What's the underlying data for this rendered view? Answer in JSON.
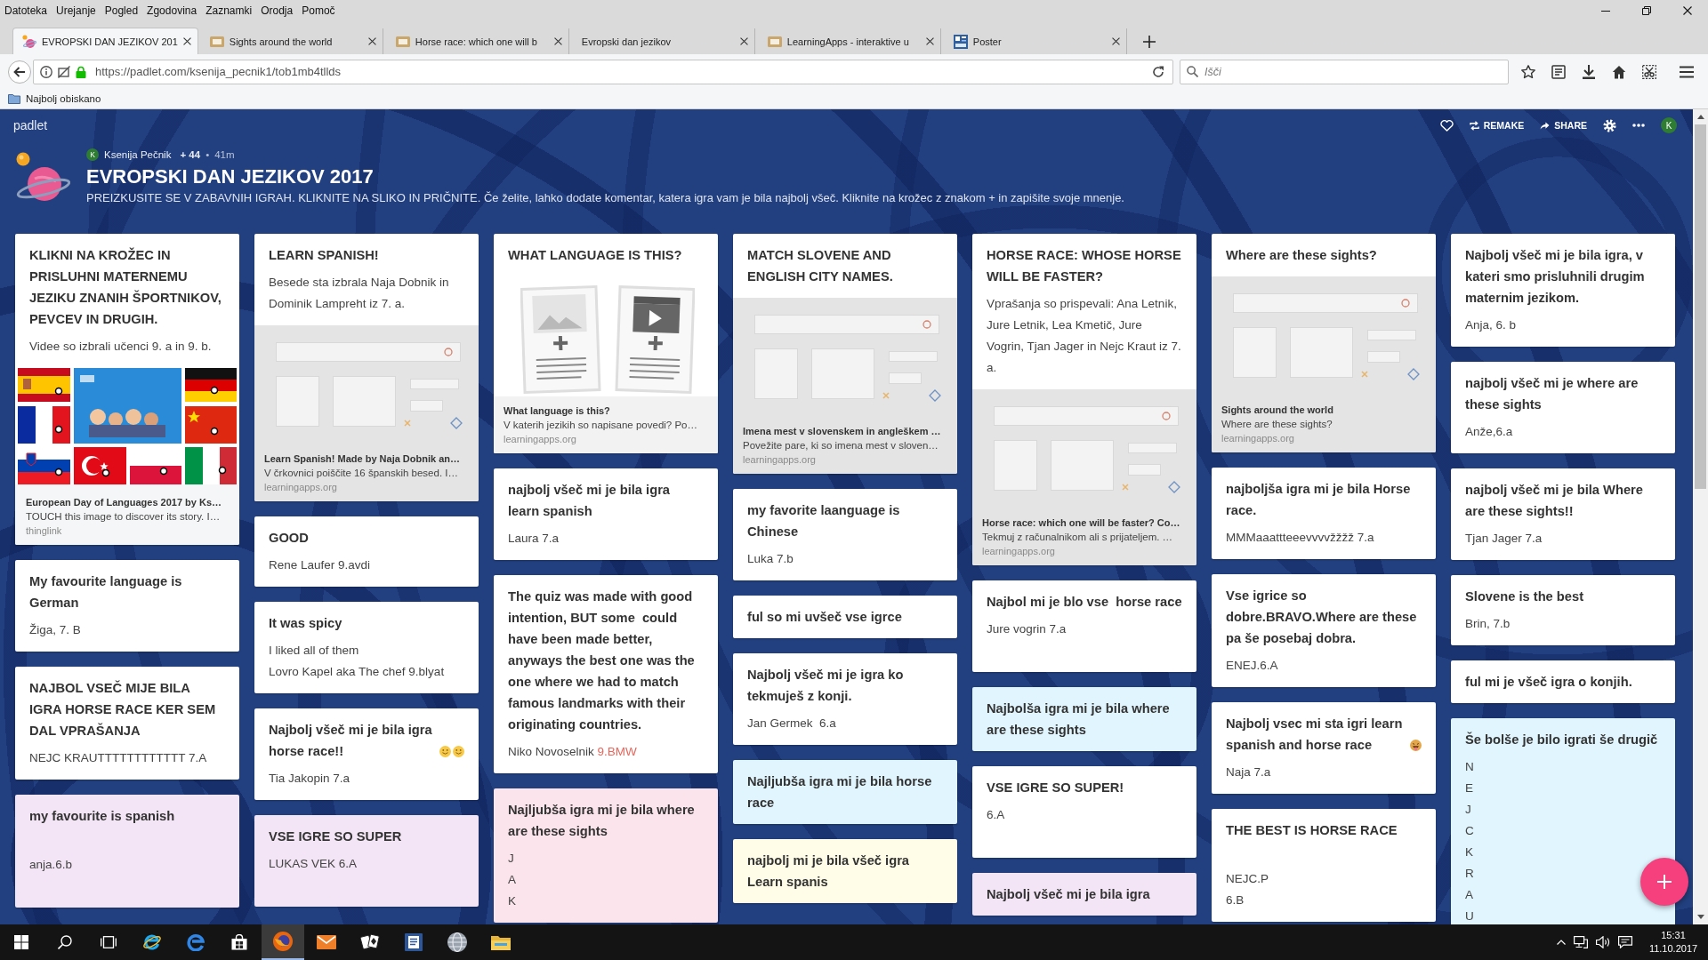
{
  "menu_bar": {
    "items": [
      "Datoteka",
      "Urejanje",
      "Pogled",
      "Zgodovina",
      "Zaznamki",
      "Orodja",
      "Pomoč"
    ]
  },
  "tabs": [
    {
      "label": "EVROPSKI DAN JEZIKOV 201",
      "selected": true,
      "kind": "padlet"
    },
    {
      "label": "Sights around the world",
      "selected": false,
      "kind": "learningapps"
    },
    {
      "label": "Horse race: which one will b",
      "selected": false,
      "kind": "learningapps"
    },
    {
      "label": "Evropski dan jezikov",
      "selected": false,
      "kind": "none"
    },
    {
      "label": "LearningApps - interaktive u",
      "selected": false,
      "kind": "learningapps"
    },
    {
      "label": "Poster",
      "selected": false,
      "kind": "poster"
    }
  ],
  "nav_bar": {
    "url": "https://padlet.com/ksenija_pecnik1/tob1mb4tllds",
    "search": {
      "placeholder": "Išči"
    }
  },
  "bookmarks_bar": {
    "items": [
      "Najbolj obiskano"
    ]
  },
  "padlet": {
    "brand": "padlet",
    "actions": [
      {
        "kind": "remake",
        "label": "REMAKE"
      },
      {
        "kind": "share",
        "label": "SHARE"
      }
    ],
    "user_initial": "K",
    "author": {
      "initial": "K",
      "name": "Ksenija Pečnik",
      "points": "+ 44",
      "separator": "•",
      "time": "41m"
    },
    "title": "EVROPSKI DAN JEZIKOV 2017",
    "description": "PREIZKUSITE SE V ZABAVNIH IGRAH. KLIKNITE NA SLIKO IN PRIČNITE. Če želite, lahko dodate komentar, katera igra vam je bila najbolj všeč. Kliknite na krožec z znakom + in zapišite svoje mnenje.",
    "columns": [
      {
        "cards": [
          {
            "color": "#ffffff",
            "title": "KLIKNI NA KROŽEC IN PRISLUHNI MATERNEMU JEZIKU ZNANIH ŠPORTNIKOV, PEVCEV IN DRUGIH.",
            "lines": [
              {
                "kind": "text",
                "text": "Videe so izbrali učenci 9. a in 9. b."
              }
            ],
            "attachment": {
              "kind": "thinglink",
              "title": "European Day of Languages 2017 by Ks…",
              "description": "TOUCH this image to discover its story. I…",
              "source": "thinglink"
            }
          },
          {
            "color": "#ffffff",
            "title": "My favourite language is German",
            "lines": [
              {
                "kind": "text",
                "text": "Žiga, 7. B"
              }
            ]
          },
          {
            "color": "#ffffff",
            "title": "NAJBOL VSEČ MIJE BILA IGRA HORSE RACE KER SEM DAL VPRAŠANJA",
            "lines": [
              {
                "kind": "text",
                "text": "NEJC KRAUTTTTTTTTTTTT 7.A"
              }
            ]
          },
          {
            "color": "#f3e5f5",
            "title": "my favourite is spanish",
            "lines": [
              {
                "kind": "blank"
              },
              {
                "kind": "text",
                "text": "anja.6.b"
              },
              {
                "kind": "blank"
              }
            ]
          }
        ]
      },
      {
        "cards": [
          {
            "color": "#ffffff",
            "title": "LEARN SPANISH!",
            "lines": [
              {
                "kind": "text",
                "text": "Besede sta izbrala Naja Dobnik in Dominik Lampreht iz 7. a."
              }
            ],
            "attachment": {
              "kind": "learningapps",
              "title": "Learn Spanish! Made by Naja Dobnik an…",
              "description": "V črkovnici poiščite 16 španskih besed. I…",
              "source": "learningapps.org"
            }
          },
          {
            "color": "#ffffff",
            "title": "GOOD",
            "lines": [
              {
                "kind": "text",
                "text": "Rene Laufer 9.avdi"
              }
            ]
          },
          {
            "color": "#ffffff",
            "title": "It was spicy",
            "lines": [
              {
                "kind": "text",
                "text": "I liked all of them"
              },
              {
                "kind": "text",
                "text": "Lovro Kapel aka The chef 9.blyat"
              }
            ]
          },
          {
            "color": "#ffffff",
            "title": "Najbolj všeč mi je bila igra horse race!!",
            "title_icons": [
              {
                "kind": "smile"
              },
              {
                "kind": "smile"
              }
            ],
            "lines": [
              {
                "kind": "text",
                "text": "Tia Jakopin 7.a"
              }
            ]
          },
          {
            "color": "#f3e5f5",
            "title": "VSE IGRE SO SUPER",
            "lines": [
              {
                "kind": "text",
                "text": "LUKAS VEK 6.A"
              },
              {
                "kind": "blank"
              }
            ]
          }
        ]
      },
      {
        "cards": [
          {
            "color": "#ffffff",
            "title": "WHAT LANGUAGE IS THIS?",
            "attachment": {
              "kind": "document",
              "title": "What language is this?",
              "description": "V katerih jezikih so napisane povedi? Po…",
              "source": "learningapps.org"
            }
          },
          {
            "color": "#ffffff",
            "title": "najbolj všeč mi je bila igra learn spanish",
            "lines": [
              {
                "kind": "text",
                "text": "Laura 7.a"
              }
            ]
          },
          {
            "color": "#ffffff",
            "title": "The quiz was made with good intention, BUT some  could have been made better, anyways the best one was the one where we had to match famous landmarks with their originating countries.",
            "lines": [
              {
                "kind": "text",
                "text": "Niko Novoselnik",
                "link": "9.BMW"
              }
            ]
          },
          {
            "color": "#fce4ec",
            "title": "Najljubša igra mi je bila where are these sights",
            "lines": [
              {
                "kind": "text",
                "text": "J"
              },
              {
                "kind": "text",
                "text": "A"
              },
              {
                "kind": "text",
                "text": "K"
              }
            ]
          }
        ]
      },
      {
        "cards": [
          {
            "color": "#ffffff",
            "title": "MATCH SLOVENE AND ENGLISH CITY NAMES.",
            "attachment": {
              "kind": "learningapps",
              "title": "Imena mest v slovenskem in angleškem …",
              "description": "Povežite pare, ki so imena mest v sloven…",
              "source": "learningapps.org"
            }
          },
          {
            "color": "#ffffff",
            "title": "my favorite laanguage is Chinese",
            "lines": [
              {
                "kind": "text",
                "text": "Luka 7.b"
              }
            ]
          },
          {
            "color": "#ffffff",
            "title": "ful so mi uvšeč vse igrce"
          },
          {
            "color": "#ffffff",
            "title": "Najbolj všeč mi je igra ko tekmuješ z konji.",
            "lines": [
              {
                "kind": "text",
                "text": "Jan Germek  6.a"
              }
            ]
          },
          {
            "color": "#e1f5fe",
            "title": "Najljubša igra mi je bila horse race"
          },
          {
            "color": "#fffde7",
            "title": "najbolj mi je bila všeč igra Learn spanis"
          }
        ]
      },
      {
        "cards": [
          {
            "color": "#ffffff",
            "title": "HORSE RACE: WHOSE HORSE WILL BE FASTER?",
            "lines": [
              {
                "kind": "text",
                "text": "Vprašanja so prispevali: Ana Letnik, Jure Letnik, Lea Kmetič, Jure Vogrin, Tjan Jager in Nejc Kraut iz 7. a."
              }
            ],
            "attachment": {
              "kind": "learningapps",
              "title": "Horse race: which one will be faster? Co…",
              "description": "Tekmuj z računalnikom ali s prijateljem. …",
              "source": "learningapps.org"
            }
          },
          {
            "color": "#ffffff",
            "title": "Najbol mi je blo vse  horse race",
            "lines": [
              {
                "kind": "text",
                "text": "Jure vogrin 7.a"
              },
              {
                "kind": "blank"
              }
            ]
          },
          {
            "color": "#e1f5fe",
            "title": "Najbolša igra mi je bila where are these sights"
          },
          {
            "color": "#ffffff",
            "title": "VSE IGRE SO SUPER!",
            "lines": [
              {
                "kind": "text",
                "text": "6.A"
              },
              {
                "kind": "blank"
              }
            ]
          },
          {
            "color": "#f3e5f5",
            "title": "Najbolj všeč mi je bila igra"
          }
        ]
      },
      {
        "cards": [
          {
            "color": "#ffffff",
            "title": "Where are these sights?",
            "attachment": {
              "kind": "learningapps",
              "title": "Sights around the world",
              "description": "Where are these sights?",
              "source": "learningapps.org"
            }
          },
          {
            "color": "#ffffff",
            "title": "najboljša igra mi je bila Horse race.",
            "lines": [
              {
                "kind": "text",
                "text": "MMMaaattteeevvvvžžžž 7.a"
              }
            ]
          },
          {
            "color": "#ffffff",
            "title": "Vse igrice so dobre.BRAVO.Where are these pa še posebaj dobra.",
            "lines": [
              {
                "kind": "text",
                "text": "ENEJ.6.A"
              }
            ]
          },
          {
            "color": "#ffffff",
            "title": "Najbolj vsec mi sta igri learn spanish and horse race",
            "title_icons": [
              {
                "kind": "tongue"
              }
            ],
            "lines": [
              {
                "kind": "text",
                "text": "Naja 7.a"
              }
            ]
          },
          {
            "color": "#ffffff",
            "title": "THE BEST IS HORSE RACE",
            "lines": [
              {
                "kind": "blank"
              },
              {
                "kind": "text",
                "text": "NEJC.P"
              },
              {
                "kind": "text",
                "text": "6.B"
              }
            ]
          }
        ]
      },
      {
        "cards": [
          {
            "color": "#ffffff",
            "title": "Najbolj všeč mi je bila igra, v kateri smo prisluhnili drugim maternim jezikom.",
            "lines": [
              {
                "kind": "text",
                "text": "Anja, 6. b"
              }
            ]
          },
          {
            "color": "#ffffff",
            "title": "najbolj všeč mi je where are these sights",
            "lines": [
              {
                "kind": "text",
                "text": "Anže,6.a"
              }
            ]
          },
          {
            "color": "#ffffff",
            "title": "najbolj všeč mi je bila Where are these sights!!",
            "lines": [
              {
                "kind": "text",
                "text": "Tjan Jager 7.a"
              }
            ]
          },
          {
            "color": "#ffffff",
            "title": "Slovene is the best",
            "lines": [
              {
                "kind": "text",
                "text": "Brin, 7.b"
              }
            ]
          },
          {
            "color": "#ffffff",
            "title": "ful mi je všeč igra o konjih."
          },
          {
            "color": "#e1f5fe",
            "title": "Še bolše je bilo igrati še drugič",
            "lines": [
              {
                "kind": "text",
                "text": "N"
              },
              {
                "kind": "text",
                "text": "E"
              },
              {
                "kind": "text",
                "text": "J"
              },
              {
                "kind": "text",
                "text": "C"
              },
              {
                "kind": "text",
                "text": "K"
              },
              {
                "kind": "text",
                "text": "R"
              },
              {
                "kind": "text",
                "text": "A"
              },
              {
                "kind": "text",
                "text": "U"
              }
            ]
          }
        ]
      }
    ]
  },
  "taskbar": {
    "apps": [
      {
        "kind": "ie",
        "selected": false
      },
      {
        "kind": "edge",
        "selected": false
      },
      {
        "kind": "store",
        "selected": false
      },
      {
        "kind": "firefox",
        "selected": true
      },
      {
        "kind": "mail",
        "selected": false
      },
      {
        "kind": "solitaire",
        "selected": false
      },
      {
        "kind": "word",
        "selected": false
      },
      {
        "kind": "globe",
        "selected": false
      },
      {
        "kind": "explorer",
        "selected": false
      }
    ],
    "clock": {
      "time": "15:31",
      "date": "11.10.2017"
    }
  }
}
